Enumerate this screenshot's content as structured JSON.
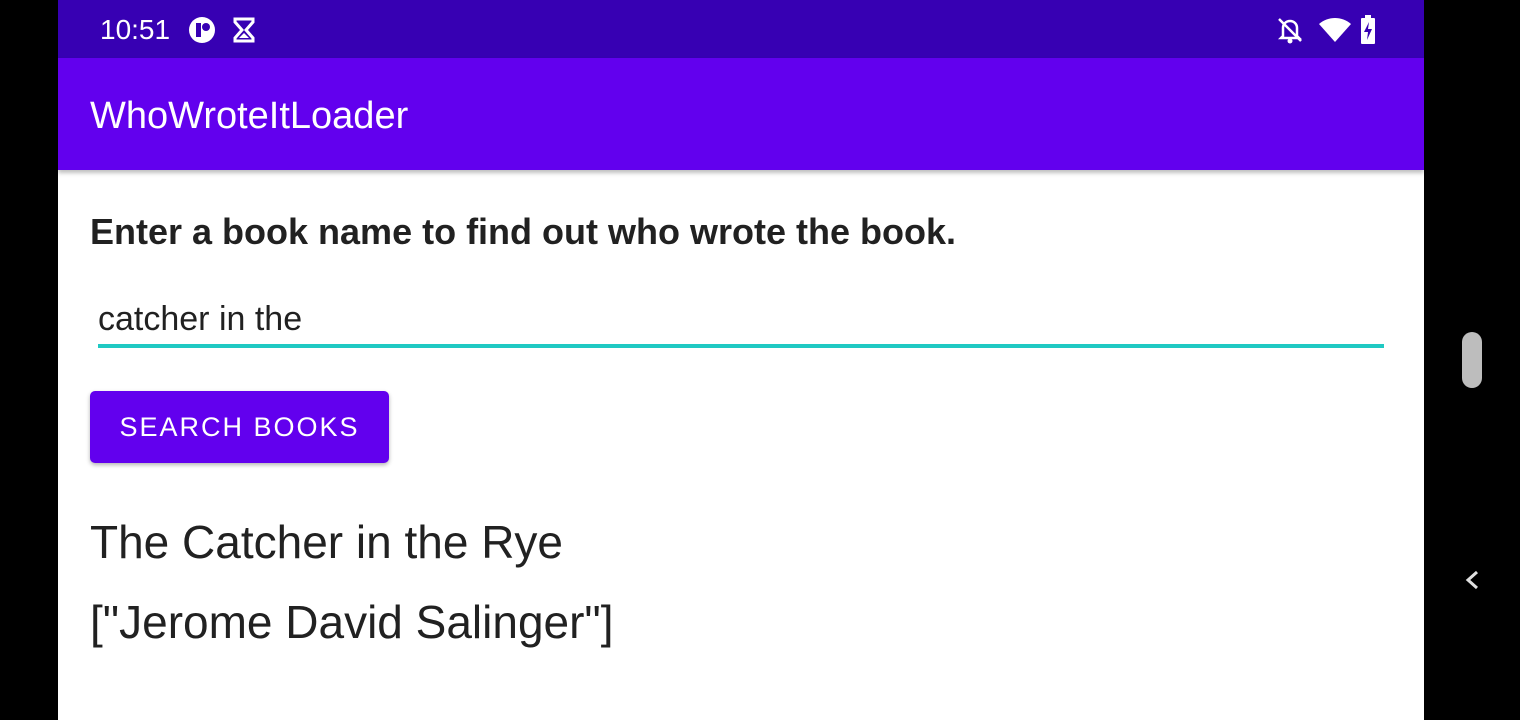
{
  "status_bar": {
    "time": "10:51",
    "left_icons": [
      "record-icon",
      "hourglass-icon"
    ],
    "right_icons": [
      "notifications-off-icon",
      "wifi-icon",
      "battery-charging-icon"
    ]
  },
  "app_bar": {
    "title": "WhoWroteItLoader"
  },
  "main": {
    "instructions": "Enter a book name to find out who wrote the book.",
    "book_input_value": "catcher in the",
    "search_button_label": "SEARCH BOOKS",
    "result_title": "The Catcher in the Rye",
    "result_author": "[\"Jerome David Salinger\"]"
  },
  "nav": {
    "icons": [
      "scroll-handle",
      "back-chevron-icon"
    ]
  },
  "colors": {
    "status_bar": "#3700b3",
    "app_bar": "#6200ee",
    "button": "#6200ee",
    "input_underline": "#1fc9c3"
  }
}
